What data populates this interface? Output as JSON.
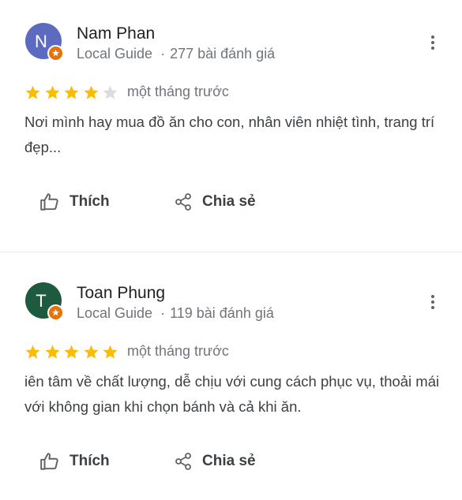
{
  "reviews": [
    {
      "avatar_letter": "N",
      "avatar_color": "#5c6bc0",
      "name": "Nam Phan",
      "badge": "Local Guide",
      "review_count": "277 bài đánh giá",
      "rating": 4,
      "max_rating": 5,
      "time": "một tháng trước",
      "text": "Nơi mình hay mua đồ ăn cho con, nhân viên nhiệt tình, trang trí đẹp...",
      "like_label": "Thích",
      "share_label": "Chia sẻ"
    },
    {
      "avatar_letter": "T",
      "avatar_color": "#1e5a3e",
      "name": "Toan Phung",
      "badge": "Local Guide",
      "review_count": "119 bài đánh giá",
      "rating": 5,
      "max_rating": 5,
      "time": "một tháng trước",
      "text": "iên tâm về chất lượng, dễ chịu với cung cách phục vụ, thoải mái với không gian khi chọn bánh và cả khi ăn.",
      "like_label": "Thích",
      "share_label": "Chia sẻ"
    }
  ],
  "colors": {
    "star_filled": "#fbbc04",
    "star_empty": "#dadce0",
    "guide_badge": "#e8710a"
  },
  "icons": [
    "more-vert-icon",
    "star-icon",
    "thumb-up-icon",
    "share-icon",
    "local-guide-badge-icon"
  ]
}
